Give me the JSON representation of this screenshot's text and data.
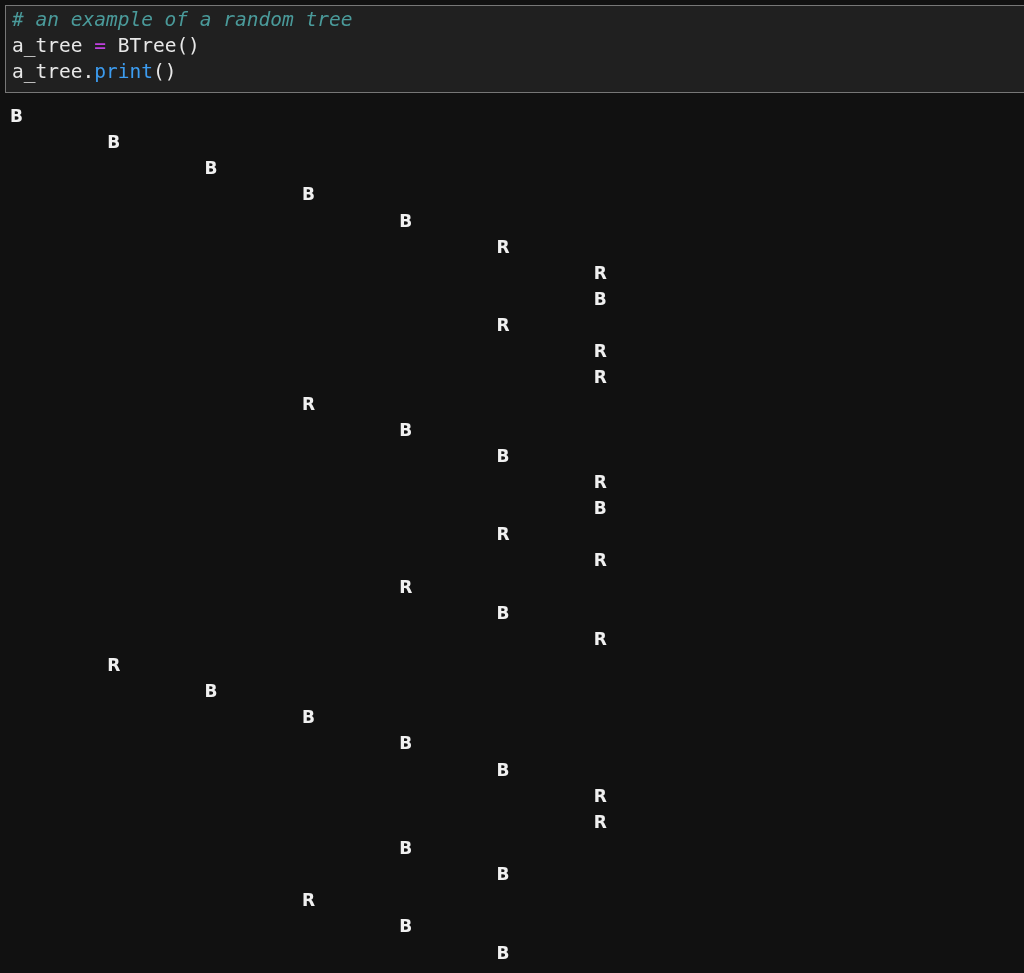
{
  "code_cell": {
    "lines": [
      [
        {
          "kind": "comment",
          "text": "# an example of a random tree"
        }
      ],
      [
        {
          "kind": "plain",
          "text": "a_tree "
        },
        {
          "kind": "operator",
          "text": "="
        },
        {
          "kind": "plain",
          "text": " BTree()"
        }
      ],
      [
        {
          "kind": "plain",
          "text": "a_tree."
        },
        {
          "kind": "builtin",
          "text": "print"
        },
        {
          "kind": "plain",
          "text": "()"
        }
      ]
    ]
  },
  "output": {
    "tree": {
      "label": "B",
      "children": [
        {
          "label": "B",
          "children": [
            {
              "label": "B",
              "children": [
                {
                  "label": "B",
                  "children": [
                    {
                      "label": "B",
                      "children": [
                        {
                          "label": "R",
                          "children": [
                            {
                              "label": "R"
                            },
                            {
                              "label": "B"
                            }
                          ]
                        },
                        {
                          "label": "R",
                          "children": [
                            {
                              "label": "R"
                            },
                            {
                              "label": "R"
                            }
                          ]
                        }
                      ]
                    }
                  ]
                },
                {
                  "label": "R",
                  "children": [
                    {
                      "label": "B",
                      "children": [
                        {
                          "label": "B",
                          "children": [
                            {
                              "label": "R"
                            },
                            {
                              "label": "B"
                            }
                          ]
                        },
                        {
                          "label": "R",
                          "children": [
                            {
                              "label": "R"
                            }
                          ]
                        }
                      ]
                    },
                    {
                      "label": "R",
                      "children": [
                        {
                          "label": "B",
                          "children": [
                            {
                              "label": "R"
                            }
                          ]
                        }
                      ]
                    }
                  ]
                }
              ]
            }
          ]
        },
        {
          "label": "R",
          "children": [
            {
              "label": "B",
              "children": [
                {
                  "label": "B",
                  "children": [
                    {
                      "label": "B",
                      "children": [
                        {
                          "label": "B",
                          "children": [
                            {
                              "label": "R"
                            },
                            {
                              "label": "R"
                            }
                          ]
                        }
                      ]
                    },
                    {
                      "label": "B",
                      "children": [
                        {
                          "label": "B"
                        }
                      ]
                    }
                  ]
                },
                {
                  "label": "R",
                  "children": [
                    {
                      "label": "B",
                      "children": [
                        {
                          "label": "B"
                        }
                      ]
                    }
                  ]
                }
              ]
            }
          ]
        }
      ]
    }
  }
}
